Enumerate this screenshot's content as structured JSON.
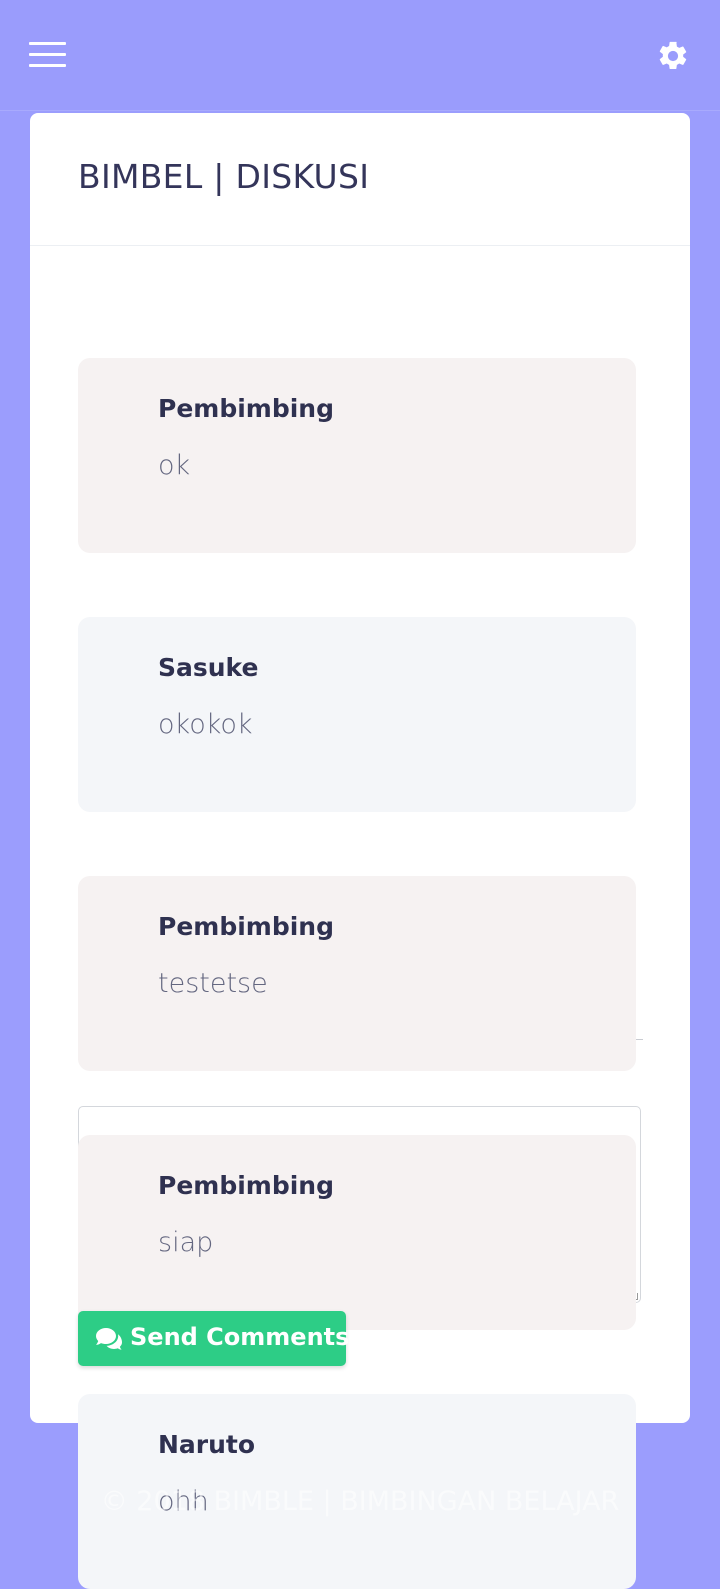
{
  "header": {
    "menu_icon": "hamburger-menu-icon",
    "settings_icon": "gear-icon"
  },
  "card": {
    "title": "BIMBEL | DISKUSI"
  },
  "messages": [
    {
      "author": "Pembimbing",
      "text": "ok"
    },
    {
      "author": "Sasuke",
      "text": "okokok"
    },
    {
      "author": "Pembimbing",
      "text": "testetse"
    },
    {
      "author": "Pembimbing",
      "text": "siap"
    },
    {
      "author": "Naruto",
      "text": "ohh"
    }
  ],
  "comment_box": {
    "value": "",
    "placeholder": ""
  },
  "send_button": {
    "label": "Send Comments",
    "icon": "comments-icon"
  },
  "footer": {
    "text": "© 2018 BIMBLE | BIMBINGAN BELAJAR"
  },
  "colors": {
    "background": "#9b9dfd",
    "card": "#ffffff",
    "send_button": "#2dcd86",
    "mentor_bubble": "#f6f2f2",
    "student_bubble": "#f4f6f9"
  }
}
